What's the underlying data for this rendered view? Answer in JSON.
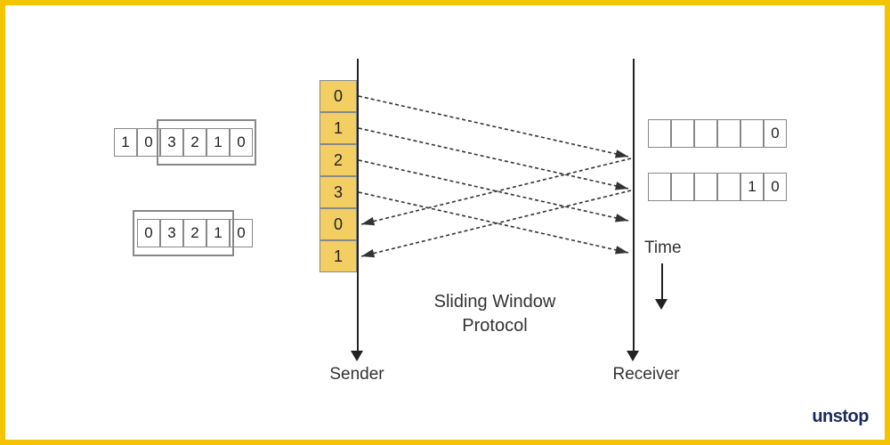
{
  "title_line1": "Sliding Window",
  "title_line2": "Protocol",
  "sender_label": "Sender",
  "receiver_label": "Receiver",
  "time_label": "Time",
  "sender_frames": [
    "0",
    "1",
    "2",
    "3",
    "0",
    "1"
  ],
  "left_buf_top": [
    "1",
    "0",
    "3",
    "2",
    "1",
    "0"
  ],
  "left_buf_bottom": [
    "0",
    "3",
    "2",
    "1",
    "0"
  ],
  "right_buf_top": [
    "",
    "",
    "",
    "",
    "",
    "0"
  ],
  "right_buf_bottom": [
    "",
    "",
    "",
    "",
    "1",
    "0"
  ],
  "logo": "unstop",
  "colors": {
    "accent": "#f5c400",
    "cell": "#f3cf63"
  },
  "arrows": [
    {
      "from": "s0",
      "to": "r0",
      "dir": "fwd"
    },
    {
      "from": "s1",
      "to": "r1",
      "dir": "fwd"
    },
    {
      "from": "s2",
      "to": "r2",
      "dir": "fwd"
    },
    {
      "from": "s3",
      "to": "r3",
      "dir": "fwd"
    },
    {
      "from": "r0",
      "to": "s4",
      "dir": "ack"
    },
    {
      "from": "r1",
      "to": "s5",
      "dir": "ack"
    }
  ]
}
